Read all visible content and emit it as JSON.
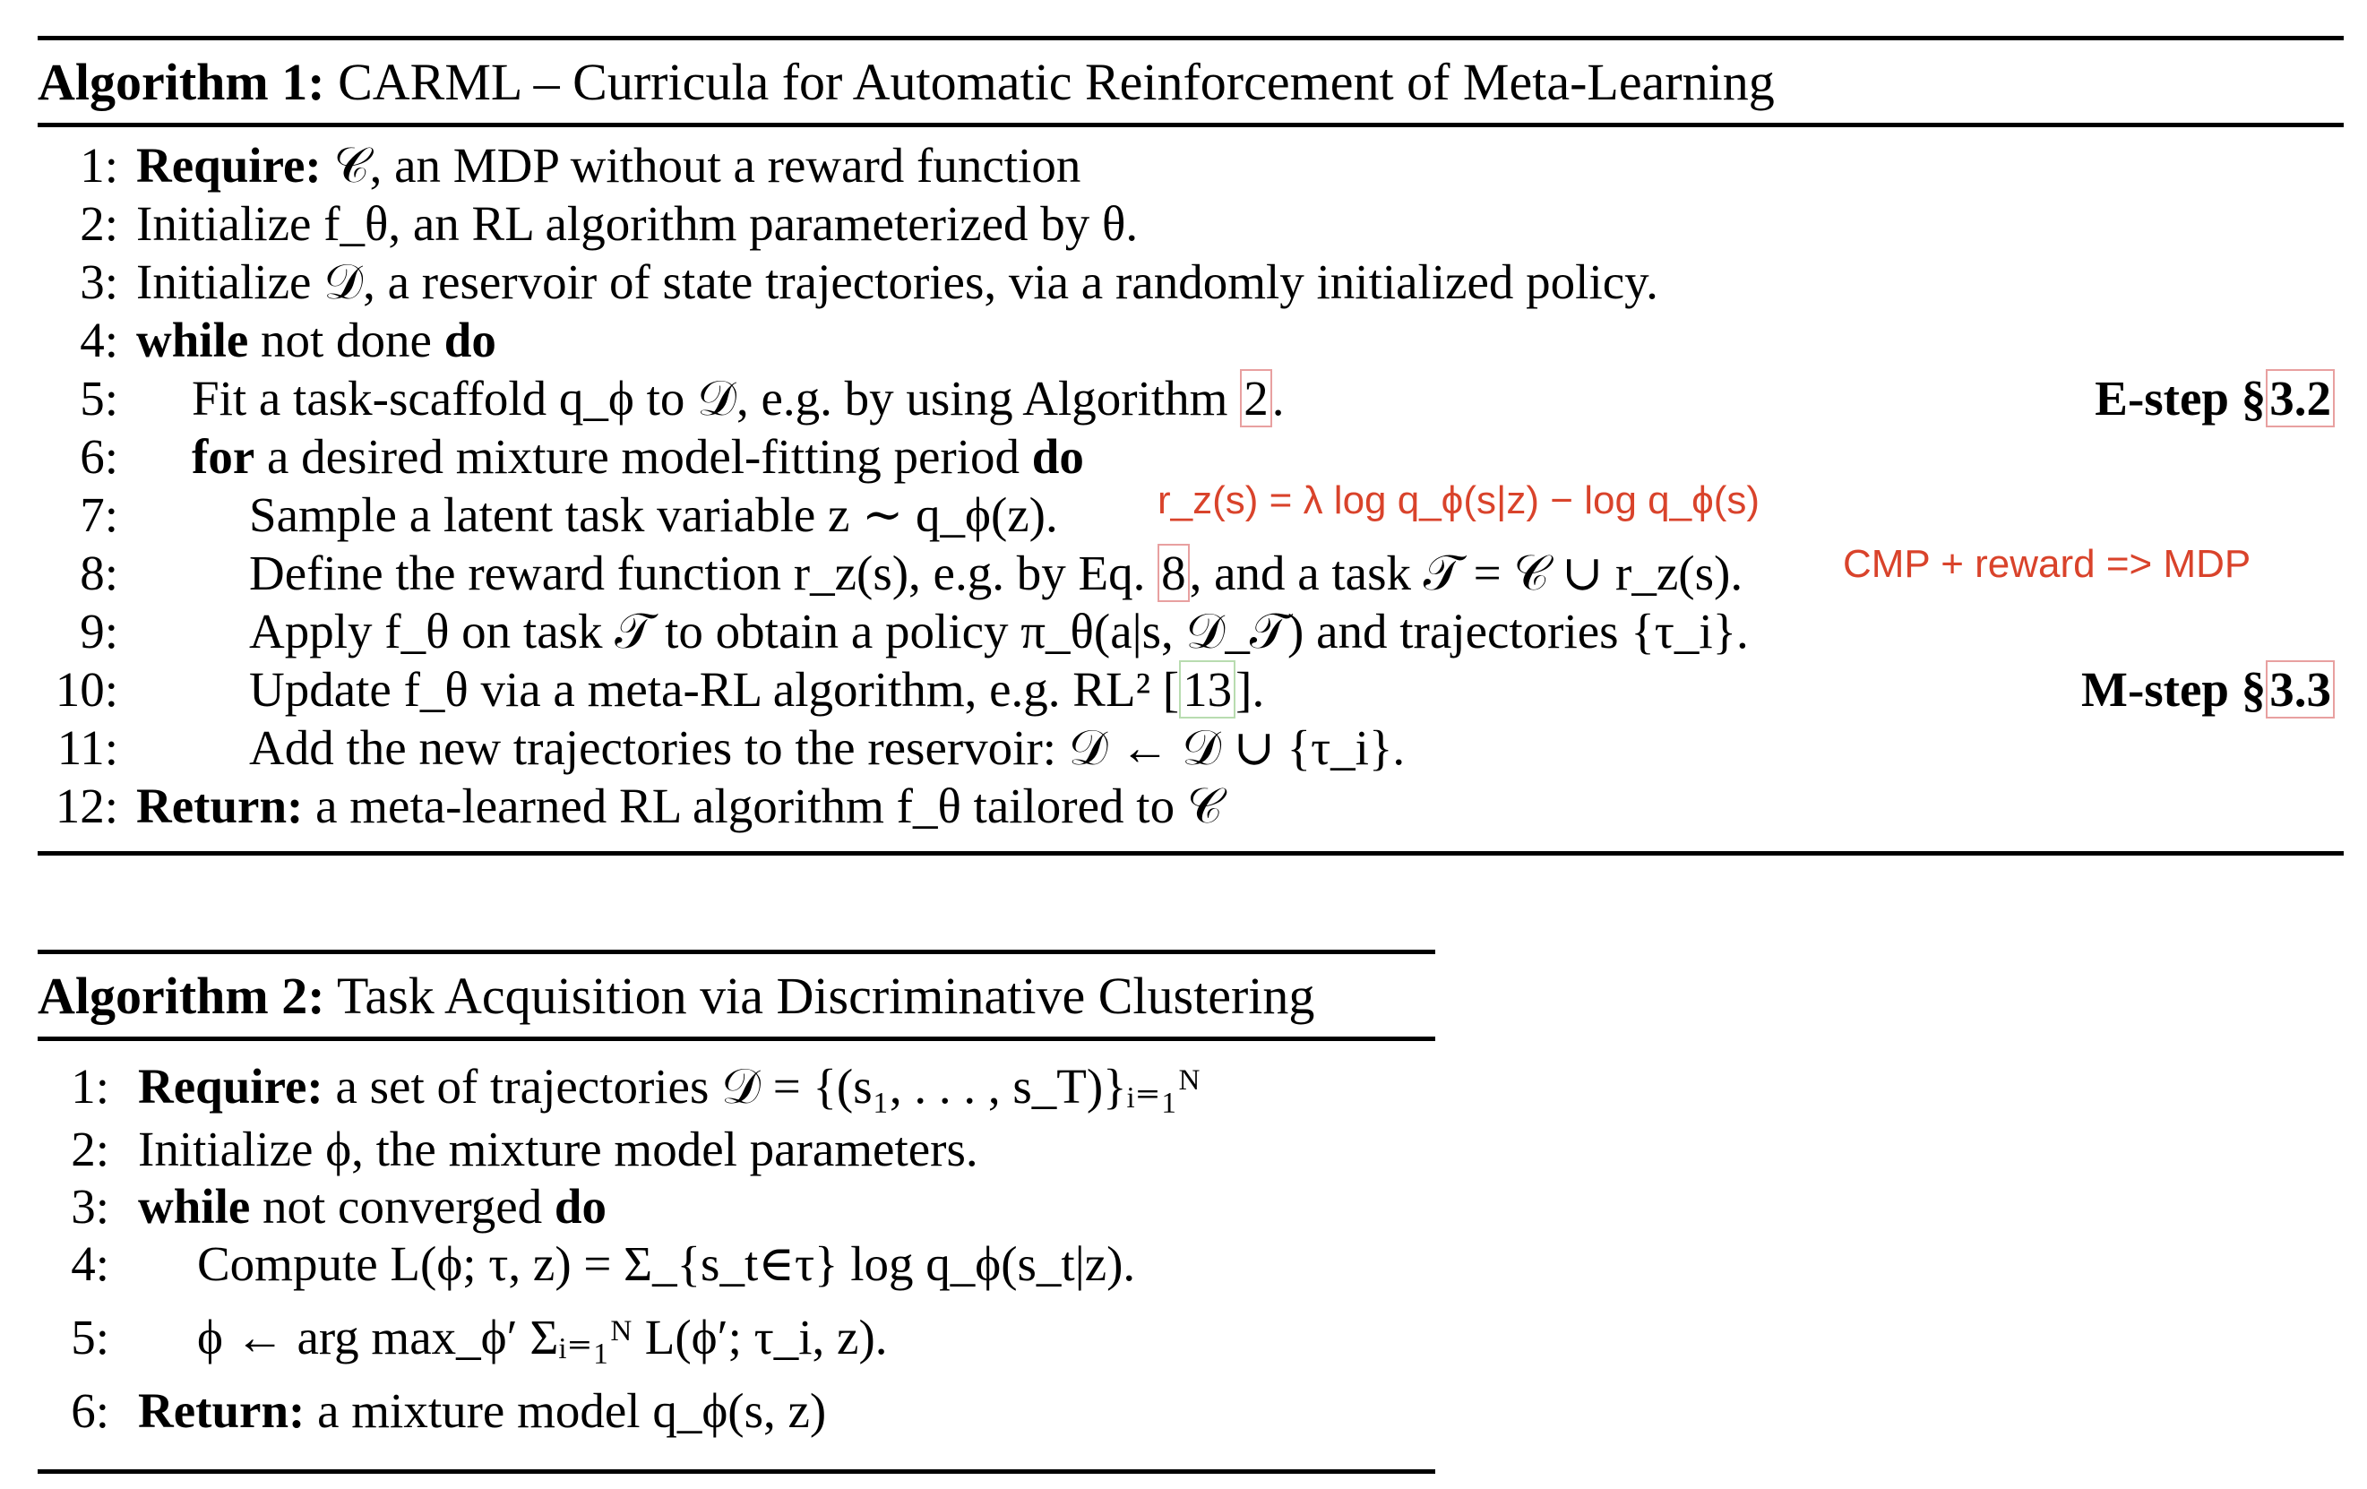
{
  "algorithm1": {
    "title_kw": "Algorithm 1:",
    "title_text": "CARML – Curricula for Automatic Reinforcement of Meta-Learning",
    "lines": [
      {
        "n": "1:",
        "kw": "Require:",
        "text": "𝒞, an MDP without a reward function"
      },
      {
        "n": "2:",
        "text": "Initialize f_θ, an RL algorithm parameterized by θ."
      },
      {
        "n": "3:",
        "text": "Initialize 𝒟, a reservoir of state trajectories, via a randomly initialized policy."
      },
      {
        "n": "4:",
        "kw": "while",
        "text": "not done",
        "kw2": "do"
      },
      {
        "n": "5:",
        "text": "Fit a task-scaffold q_ϕ to 𝒟, e.g. by using Algorithm",
        "ref": "2",
        "tail": ".",
        "right": "E-step §",
        "right_ref": "3.2"
      },
      {
        "n": "6:",
        "kw": "for",
        "text": "a desired mixture model-fitting period",
        "kw2": "do"
      },
      {
        "n": "7:",
        "text": "Sample a latent task variable z ∼ q_ϕ(z)."
      },
      {
        "n": "8:",
        "text": "Define the reward function r_z(s), e.g. by Eq.",
        "ref": "8",
        "tail": ", and a task 𝒯 = 𝒞 ∪ r_z(s)."
      },
      {
        "n": "9:",
        "text": "Apply f_θ on task 𝒯 to obtain a policy π_θ(a|s, 𝒟_𝒯) and trajectories {τ_i}."
      },
      {
        "n": "10:",
        "text": "Update f_θ via a meta-RL algorithm, e.g. RL² [",
        "ref": "13",
        "tail": "].",
        "right": "M-step §",
        "right_ref": "3.3"
      },
      {
        "n": "11:",
        "text": "Add the new trajectories to the reservoir: 𝒟 ← 𝒟 ∪ {τ_i}."
      },
      {
        "n": "12:",
        "kw": "Return:",
        "text": "a meta-learned RL algorithm f_θ tailored to 𝒞"
      }
    ]
  },
  "annotations": {
    "reward_formula": "r_z(s) = λ log q_ϕ(s|z) − log q_ϕ(s)",
    "cmp_note": "CMP + reward => MDP",
    "color": "#d9432b"
  },
  "algorithm2": {
    "title_kw": "Algorithm 2:",
    "title_text": "Task Acquisition via Discriminative Clustering",
    "lines": [
      {
        "n": "1:",
        "kw": "Require:",
        "text": "a set of trajectories 𝒟 = {(s₁, . . . , s_T)}ᵢ₌₁ᴺ"
      },
      {
        "n": "2:",
        "text": "Initialize ϕ, the mixture model parameters."
      },
      {
        "n": "3:",
        "kw": "while",
        "text": "not converged",
        "kw2": "do"
      },
      {
        "n": "4:",
        "text": "Compute L(ϕ; τ, z) = Σ_{s_t∈τ} log q_ϕ(s_t|z)."
      },
      {
        "n": "5:",
        "text": "ϕ ← arg max_ϕ′ Σᵢ₌₁ᴺ L(ϕ′; τ_i, z)."
      },
      {
        "n": "6:",
        "kw": "Return:",
        "text": "a mixture model q_ϕ(s, z)"
      }
    ]
  }
}
